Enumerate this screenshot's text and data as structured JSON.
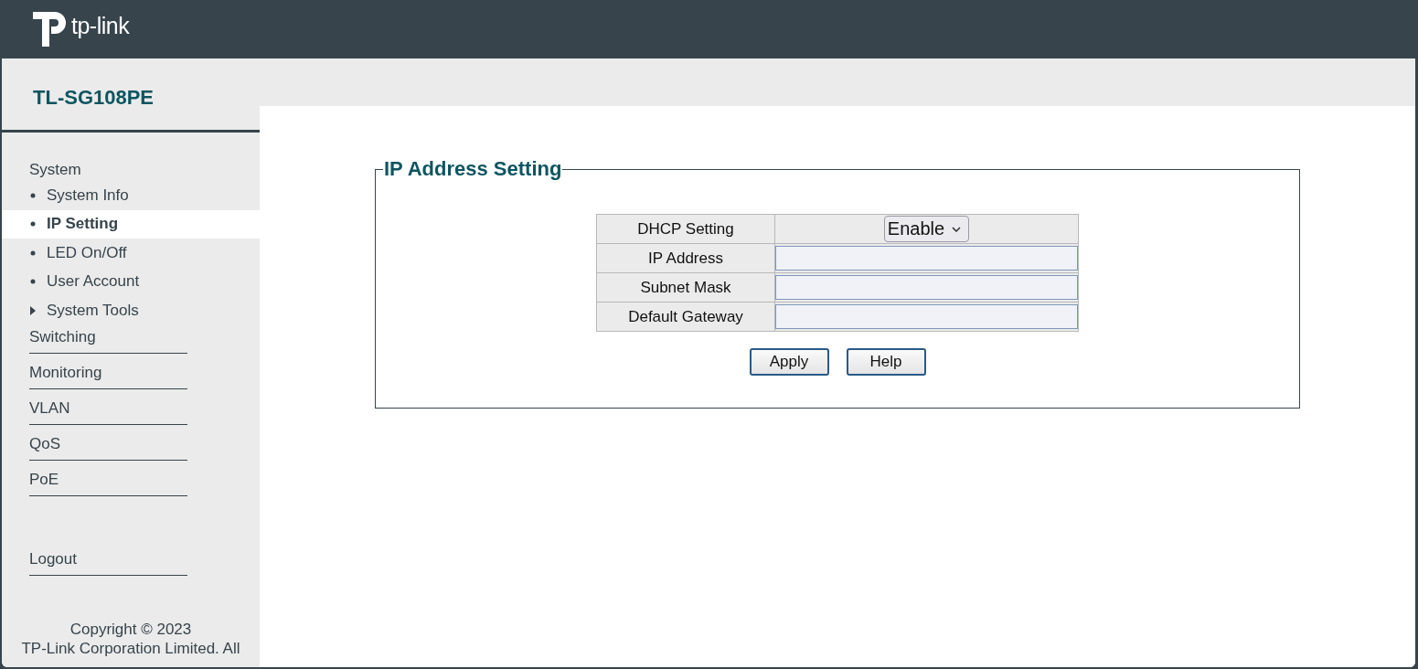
{
  "header": {
    "logo_text": "tp-link"
  },
  "sidebar": {
    "model": "TL-SG108PE",
    "sections": [
      {
        "label": "System",
        "expanded": true,
        "children": [
          {
            "label": "System Info",
            "kind": "leaf",
            "selected": false
          },
          {
            "label": "IP Setting",
            "kind": "leaf",
            "selected": true
          },
          {
            "label": "LED On/Off",
            "kind": "leaf",
            "selected": false
          },
          {
            "label": "User Account",
            "kind": "leaf",
            "selected": false
          },
          {
            "label": "System Tools",
            "kind": "folder",
            "selected": false
          }
        ]
      },
      {
        "label": "Switching",
        "expanded": false
      },
      {
        "label": "Monitoring",
        "expanded": false
      },
      {
        "label": "VLAN",
        "expanded": false
      },
      {
        "label": "QoS",
        "expanded": false
      },
      {
        "label": "PoE",
        "expanded": false
      }
    ],
    "logout": "Logout",
    "copyright": [
      "Copyright © 2023",
      "TP-Link Corporation Limited. All"
    ]
  },
  "panel": {
    "title": "IP Address Setting",
    "rows": [
      {
        "label": "DHCP Setting",
        "kind": "select",
        "value": "Enable"
      },
      {
        "label": "IP Address",
        "kind": "input"
      },
      {
        "label": "Subnet Mask",
        "kind": "input"
      },
      {
        "label": "Default Gateway",
        "kind": "input"
      }
    ],
    "buttons": [
      "Apply",
      "Help"
    ]
  }
}
